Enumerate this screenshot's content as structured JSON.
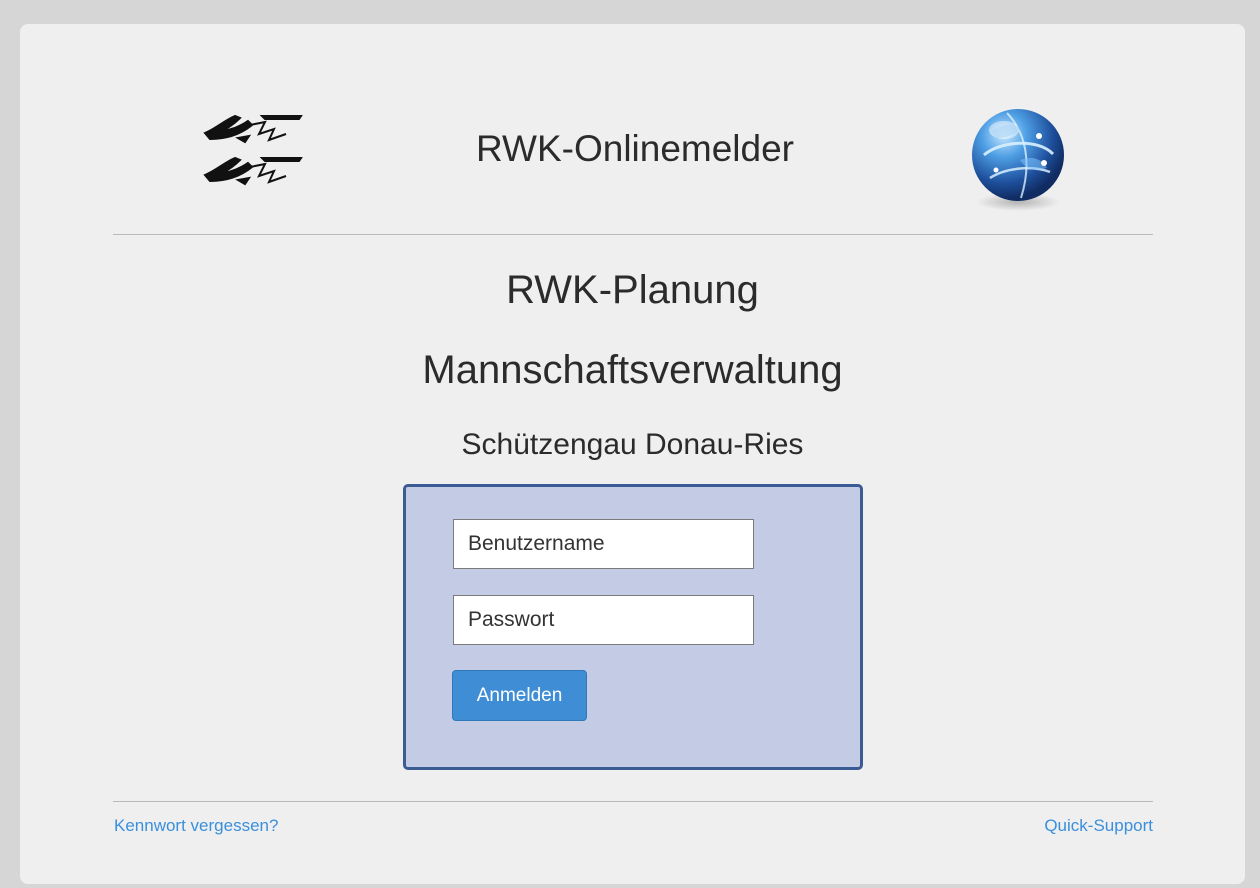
{
  "header": {
    "app_title": "RWK-Onlinemelder",
    "logo_left_icon": "federation-logo-icon",
    "logo_right_icon": "globe-icon"
  },
  "main": {
    "title": "RWK-Planung",
    "subtitle": "Mannschaftsverwaltung",
    "region": "Schützengau Donau-Ries"
  },
  "login": {
    "username": {
      "placeholder": "Benutzername",
      "value": ""
    },
    "password": {
      "placeholder": "Passwort",
      "value": ""
    },
    "submit_label": "Anmelden"
  },
  "footer": {
    "forgot_password": "Kennwort vergessen?",
    "support": "Quick-Support"
  },
  "colors": {
    "background": "#efefef",
    "login_box": "#c3cbe5",
    "login_border": "#3b5b95",
    "button": "#3f8ed5",
    "link": "#3a8fdd"
  }
}
